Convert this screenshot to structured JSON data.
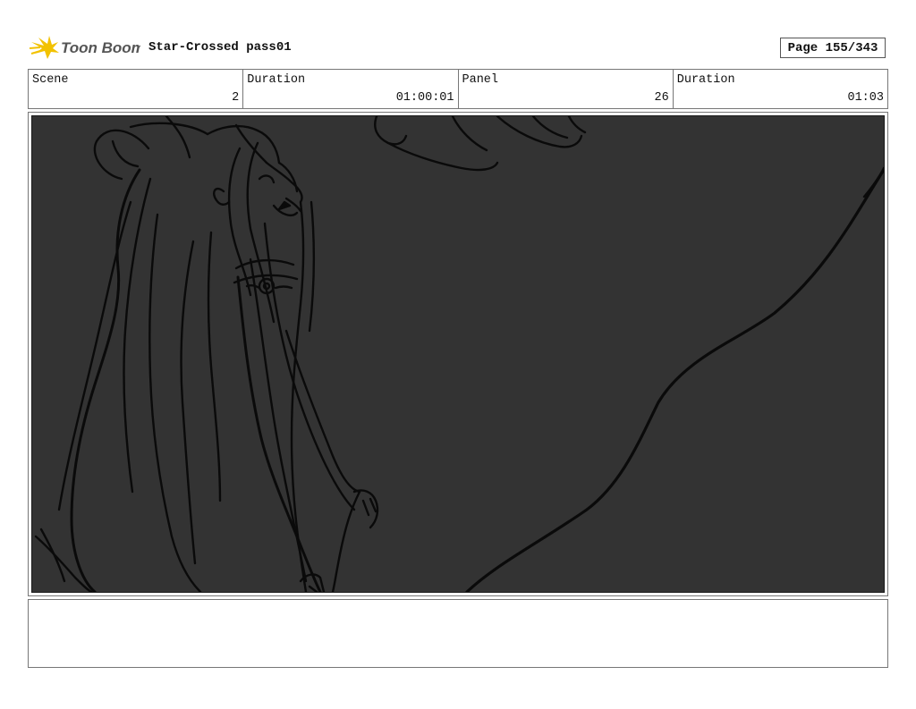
{
  "header": {
    "logo_text": "Toon Boom",
    "title": "Star-Crossed pass01",
    "page": "Page 155/343"
  },
  "info": {
    "scene_label": "Scene",
    "scene_value": "2",
    "duration1_label": "Duration",
    "duration1_value": "01:00:01",
    "panel_label": "Panel",
    "panel_value": "26",
    "duration2_label": "Duration",
    "duration2_value": "01:03"
  },
  "panel": {
    "background_color": "#333333",
    "line_color": "#0a0a0a"
  },
  "notes": {
    "text": ""
  },
  "colors": {
    "logo_star": "#f2c200",
    "logo_text": "#555555"
  }
}
